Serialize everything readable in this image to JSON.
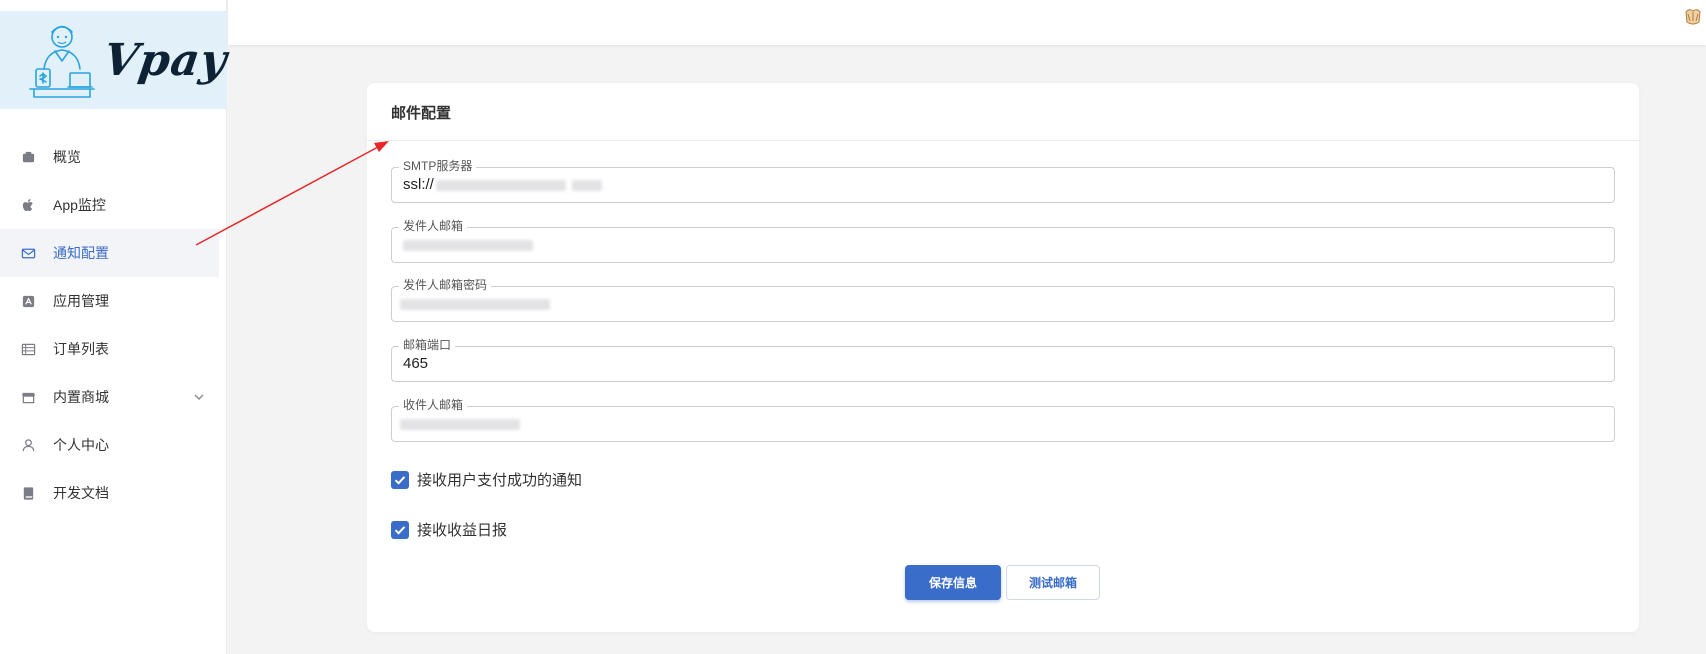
{
  "logo": {
    "text": "Vpay"
  },
  "sidebar": {
    "items": [
      {
        "label": "概览",
        "icon": "dashboard-icon"
      },
      {
        "label": "App监控",
        "icon": "apple-icon"
      },
      {
        "label": "通知配置",
        "icon": "mail-icon",
        "active": true
      },
      {
        "label": "应用管理",
        "icon": "app-store-icon"
      },
      {
        "label": "订单列表",
        "icon": "list-icon"
      },
      {
        "label": "内置商城",
        "icon": "store-icon",
        "expandable": true
      },
      {
        "label": "个人中心",
        "icon": "user-icon"
      },
      {
        "label": "开发文档",
        "icon": "book-icon"
      }
    ]
  },
  "card": {
    "title": "邮件配置",
    "fields": {
      "smtp": {
        "label": "SMTP服务器",
        "value_prefix": "ssl://"
      },
      "sender_email": {
        "label": "发件人邮箱"
      },
      "sender_password": {
        "label": "发件人邮箱密码"
      },
      "port": {
        "label": "邮箱端口",
        "value": "465"
      },
      "receiver_email": {
        "label": "收件人邮箱"
      }
    },
    "checkboxes": {
      "payment_notify": {
        "label": "接收用户支付成功的通知",
        "checked": true
      },
      "daily_report": {
        "label": "接收收益日报",
        "checked": true
      }
    },
    "buttons": {
      "save": "保存信息",
      "test": "测试邮箱"
    }
  },
  "colors": {
    "accent": "#3a6cc9",
    "logo_bg": "#e2f0fa",
    "annotation_arrow": "#e8262a"
  }
}
